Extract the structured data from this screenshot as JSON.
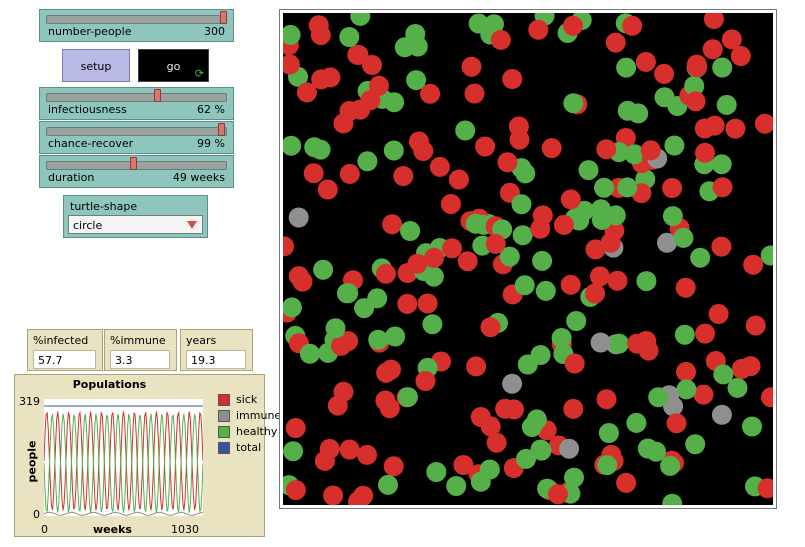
{
  "sliders": [
    {
      "name": "number-people",
      "value": "300",
      "fraction": 1.0
    },
    {
      "name": "infectiousness",
      "value": "62 %",
      "fraction": 0.62
    },
    {
      "name": "chance-recover",
      "value": "99 %",
      "fraction": 0.99
    },
    {
      "name": "duration",
      "value": "49 weeks",
      "fraction": 0.48
    }
  ],
  "buttons": {
    "setup": "setup",
    "go": "go"
  },
  "chooser": {
    "label": "turtle-shape",
    "value": "circle"
  },
  "monitors": [
    {
      "label": "%infected",
      "value": "57.7"
    },
    {
      "label": "%immune",
      "value": "3.3"
    },
    {
      "label": "years",
      "value": "19.3"
    }
  ],
  "plot": {
    "title": "Populations",
    "xlabel": "weeks",
    "ylabel": "people",
    "xmin": "0",
    "xmax": "1030",
    "ymin": "0",
    "ymax": "319"
  },
  "chart_data": {
    "type": "line",
    "title": "Populations",
    "xlabel": "weeks",
    "ylabel": "people",
    "xlim": [
      0,
      1030
    ],
    "ylim": [
      0,
      319
    ],
    "series": [
      {
        "name": "sick",
        "color": "#d7302c"
      },
      {
        "name": "immune",
        "color": "#8f8f8f"
      },
      {
        "name": "healthy",
        "color": "#55b04a"
      },
      {
        "name": "total",
        "color": "#3455a4",
        "values_constant": 300
      }
    ],
    "legend_position": "right"
  },
  "colors": {
    "sick": "#d7302c",
    "immune": "#8f8f8f",
    "healthy": "#55b04a",
    "total": "#3455a4",
    "slider_bg": "#8ec6bd",
    "monitor_bg": "#e9e3c1",
    "setup_button_bg": "#b9b9e6",
    "world_bg": "#000000"
  },
  "icons": {
    "go_forever": "refresh-arrows-icon",
    "chooser_arrow": "dropdown-triangle-icon"
  }
}
